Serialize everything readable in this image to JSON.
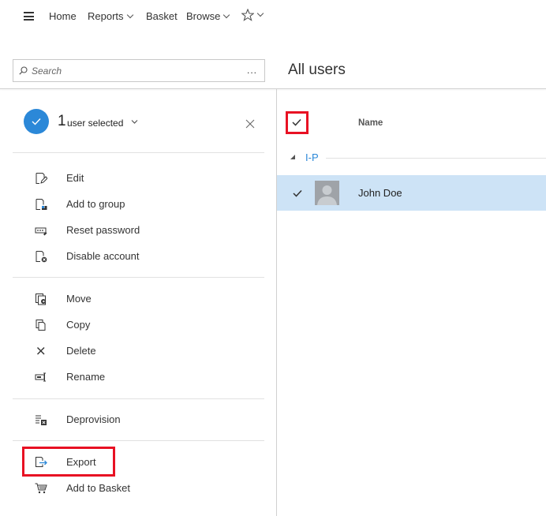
{
  "nav": {
    "home": "Home",
    "reports": "Reports",
    "basket": "Basket",
    "browse": "Browse"
  },
  "search": {
    "placeholder": "Search",
    "more": "..."
  },
  "page_title": "All users",
  "selection": {
    "count": "1",
    "label": "user selected"
  },
  "actions_group1": [
    {
      "label": "Edit",
      "icon": "edit-icon"
    },
    {
      "label": "Add to group",
      "icon": "add-to-group-icon"
    },
    {
      "label": "Reset password",
      "icon": "reset-password-icon"
    },
    {
      "label": "Disable account",
      "icon": "disable-account-icon"
    }
  ],
  "actions_group2": [
    {
      "label": "Move",
      "icon": "move-icon"
    },
    {
      "label": "Copy",
      "icon": "copy-icon"
    },
    {
      "label": "Delete",
      "icon": "delete-icon"
    },
    {
      "label": "Rename",
      "icon": "rename-icon"
    }
  ],
  "actions_group3": [
    {
      "label": "Deprovision",
      "icon": "deprovision-icon"
    }
  ],
  "actions_group4": [
    {
      "label": "Export",
      "icon": "export-icon"
    },
    {
      "label": "Add to Basket",
      "icon": "basket-icon"
    }
  ],
  "list": {
    "column_name": "Name",
    "group_label": "I-P",
    "rows": [
      {
        "name": "John Doe",
        "selected": true
      }
    ]
  },
  "colors": {
    "accent": "#2b88d8",
    "selected_row": "#cde3f6",
    "highlight": "#e81123"
  }
}
